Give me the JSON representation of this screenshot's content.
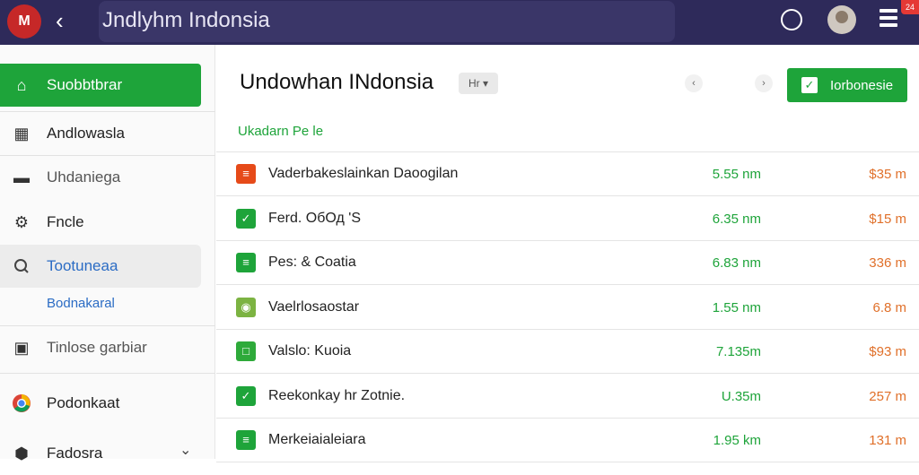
{
  "topbar": {
    "logo": "M",
    "back_icon": "‹",
    "title": "Jndlyhm Indonsia",
    "notification_badge": "24",
    "accent": "#2e2a5a"
  },
  "sidebar": {
    "items": [
      {
        "label": "Suobbtbrar",
        "icon": "home-icon",
        "glyph": "⌂"
      },
      {
        "label": "Andlowasla",
        "icon": "calendar-icon",
        "glyph": "▦"
      },
      {
        "label": "Uhdaniega",
        "icon": "card-icon",
        "glyph": "▬"
      },
      {
        "label": "Fncle",
        "icon": "gear-icon",
        "glyph": "⚙"
      },
      {
        "label": "Tootuneaa",
        "icon": "search-icon",
        "glyph": "🔍"
      },
      {
        "label": "Bodnakaral",
        "icon": ""
      },
      {
        "label": "Tinlose garbiar",
        "icon": "clipboard-icon",
        "glyph": "▣"
      },
      {
        "label": "Podonkaat",
        "icon": "chrome-icon",
        "glyph": "◉"
      },
      {
        "label": "Fadosra",
        "icon": "shield-icon",
        "glyph": "⬢"
      }
    ],
    "expand_glyph": "⌄",
    "active_color": "#1ea43a"
  },
  "main": {
    "title": "Undowhan INdonsia",
    "filter_chip": "Hr ▾",
    "nav_prev": "‹",
    "nav_next": "›",
    "primary_button": "Iorbonesie",
    "section_label": "Ukadarn Pe le",
    "rows": [
      {
        "name": "Vaderbakeslainkan Daoogilan",
        "time": "5.55 nm",
        "price": "$35 m",
        "icon_color": "#e64a19",
        "glyph": "≡"
      },
      {
        "name": "Ferd. ОбОд 'S",
        "time": "6.35 nm",
        "price": "$15 m",
        "icon_color": "#1ea43a",
        "glyph": "✓"
      },
      {
        "name": "Pes: & Coatia",
        "time": "6.83 nm",
        "price": "336 m",
        "icon_color": "#1ea43a",
        "glyph": "≡"
      },
      {
        "name": "Vaelrlosaostar",
        "time": "1.55 nm",
        "price": "6.8 m",
        "icon_color": "#7cb342",
        "glyph": "◉"
      },
      {
        "name": "Valslo: Kuoia",
        "time": "7.135m",
        "price": "$93 m",
        "icon_color": "#2eaa3a",
        "glyph": "□"
      },
      {
        "name": "Reekonkay hr Zotnie.",
        "time": "U.35m",
        "price": "257 m",
        "icon_color": "#1ea43a",
        "glyph": "✓"
      },
      {
        "name": "Merkeiaialeiara",
        "time": "1.95 km",
        "price": "131 m",
        "icon_color": "#1ea43a",
        "glyph": "≡"
      }
    ]
  }
}
